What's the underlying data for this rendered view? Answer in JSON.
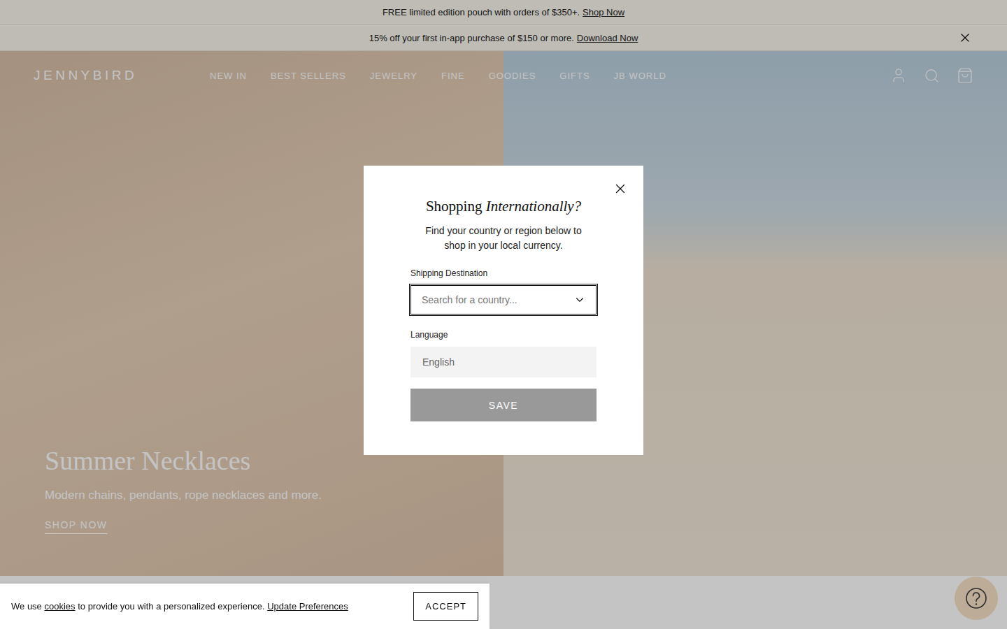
{
  "announcements": [
    {
      "text": "FREE limited edition pouch with orders of $350+.",
      "link": "Shop Now",
      "closable": false
    },
    {
      "text": "15% off your first in-app purchase of $150 or more.",
      "link": "Download Now",
      "closable": true
    }
  ],
  "header": {
    "logo": "JENNYBIRD",
    "nav": [
      "NEW IN",
      "BEST SELLERS",
      "JEWELRY",
      "FINE",
      "GOODIES",
      "GIFTS",
      "JB WORLD"
    ]
  },
  "hero": {
    "title": "Summer Necklaces",
    "subtitle": "Modern chains, pendants, rope necklaces and more.",
    "cta": "SHOP NOW"
  },
  "modal": {
    "title": "Shopping",
    "title_emphasis": "Internationally?",
    "description": "Find your country or region below to shop in your local currency.",
    "fields": [
      {
        "label": "Shipping Destination",
        "kind": "search",
        "placeholder": "Search for a country...",
        "value": "",
        "focused": true
      },
      {
        "label": "Language",
        "kind": "select",
        "placeholder": "",
        "value": "English",
        "focused": false
      }
    ],
    "button": "SAVE",
    "button_disabled": true
  },
  "cookie_banner": {
    "text_before": "We use",
    "link": "cookies",
    "text_after": "to provide you with a personalized experience.",
    "preferences_link": "Update Preferences",
    "button": "ACCEPT"
  }
}
